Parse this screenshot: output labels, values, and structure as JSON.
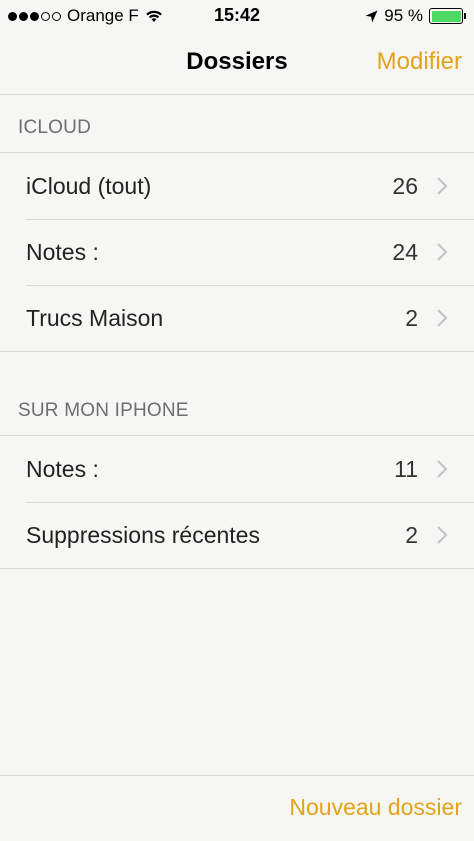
{
  "status_bar": {
    "carrier": "Orange F",
    "time": "15:42",
    "battery": "95 %",
    "signal_bars_filled": 3,
    "signal_bars_total": 5
  },
  "nav": {
    "title": "Dossiers",
    "edit_label": "Modifier"
  },
  "sections": [
    {
      "header": "ICLOUD",
      "rows": [
        {
          "label": "iCloud (tout)",
          "count": "26"
        },
        {
          "label": "Notes :",
          "count": "24"
        },
        {
          "label": "Trucs Maison",
          "count": "2"
        }
      ]
    },
    {
      "header": "SUR MON IPHONE",
      "rows": [
        {
          "label": "Notes :",
          "count": "11"
        },
        {
          "label": "Suppressions récentes",
          "count": "2"
        }
      ]
    }
  ],
  "toolbar": {
    "new_folder_label": "Nouveau dossier"
  },
  "colors": {
    "accent": "#e3a21a",
    "battery": "#4cd964",
    "background": "#f6f6f4"
  }
}
